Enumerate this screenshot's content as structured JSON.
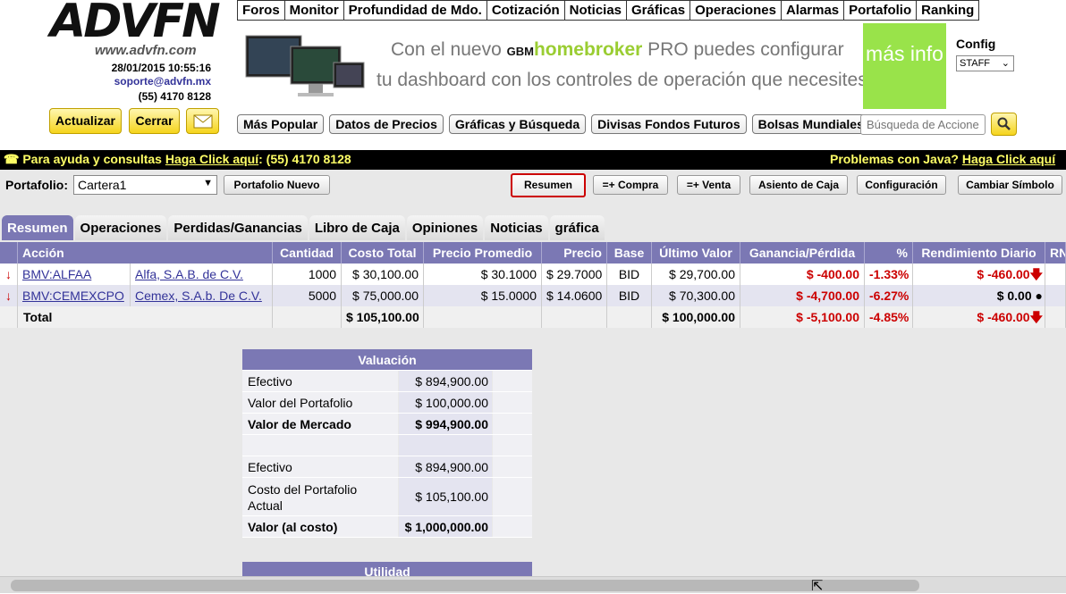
{
  "header": {
    "logo": "ADVFN",
    "logo_url": "www.advfn.com",
    "datetime": "28/01/2015 10:55:16",
    "support_email": "soporte@advfn.mx",
    "support_phone": "(55) 4170 8128",
    "refresh_label": "Actualizar",
    "close_label": "Cerrar",
    "mail_icon": "envelope-icon"
  },
  "topnav": [
    "Foros",
    "Monitor",
    "Profundidad de Mdo.",
    "Cotización",
    "Noticias",
    "Gráficas",
    "Operaciones",
    "Alarmas",
    "Portafolio",
    "Ranking"
  ],
  "banner": {
    "prefix": "Con el nuevo ",
    "brand_a": "GBM",
    "brand_b": "homebroker",
    "suffix": " PRO puedes configurar",
    "line2": "tu dashboard con los controles de operación que necesites",
    "more_info": "más info"
  },
  "config": {
    "label": "Config",
    "value": "STAFF"
  },
  "subnav": [
    "Más Popular",
    "Datos de Precios",
    "Gráficas y Búsqueda",
    "Divisas Fondos Futuros",
    "Bolsas Mundiales"
  ],
  "search": {
    "placeholder": "Búsqueda de Acciones"
  },
  "helpbar": {
    "left_prefix": "Para ayuda y consultas ",
    "left_link": "Haga Click aquí",
    "left_suffix": ": (55) 4170 8128",
    "right_prefix": "Problemas con Java? ",
    "right_link": "Haga Click aquí"
  },
  "portfolio": {
    "label": "Portafolio:",
    "selected": "Cartera1",
    "new_button": "Portafolio Nuevo",
    "actions": [
      "Resumen",
      "=+ Compra",
      "=+ Venta",
      "Asiento de Caja",
      "Configuración",
      "Cambiar Símbolo"
    ]
  },
  "tabs": [
    "Resumen",
    "Operaciones",
    "Perdidas/Ganancias",
    "Libro de Caja",
    "Opiniones",
    "Noticias",
    "gráfica"
  ],
  "table": {
    "headers": [
      "Acción",
      "Cantidad",
      "Costo Total",
      "Precio Promedio",
      "Precio",
      "Base",
      "Último Valor",
      "Ganancia/Pérdida",
      "%",
      "Rendimiento Diario",
      "RN"
    ],
    "rows": [
      {
        "symbol": "BMV:ALFAA",
        "name": "Alfa, S.A.B. de C.V.",
        "qty": "1000",
        "cost": "$ 30,100.00",
        "avg": "$ 30.1000",
        "price": "$ 29.7000",
        "base": "BID",
        "last": "$ 29,700.00",
        "gain": "$ -400.00",
        "pct": "-1.33%",
        "daily": "$ -460.00"
      },
      {
        "symbol": "BMV:CEMEXCPO",
        "name": "Cemex, S.A.b. De C.V.",
        "qty": "5000",
        "cost": "$ 75,000.00",
        "avg": "$ 15.0000",
        "price": "$ 14.0600",
        "base": "BID",
        "last": "$ 70,300.00",
        "gain": "$ -4,700.00",
        "pct": "-6.27%",
        "daily": "$ 0.00"
      }
    ],
    "total": {
      "label": "Total",
      "cost": "$ 105,100.00",
      "last": "$ 100,000.00",
      "gain": "$ -5,100.00",
      "pct": "-4.85%",
      "daily": "$ -460.00"
    }
  },
  "valuation": {
    "title": "Valuación",
    "rows": [
      {
        "label": "Efectivo",
        "value": "$ 894,900.00"
      },
      {
        "label": "Valor del Portafolio",
        "value": "$ 100,000.00"
      },
      {
        "label": "Valor de Mercado",
        "value": "$ 994,900.00"
      },
      {
        "label": "",
        "value": ""
      },
      {
        "label": "Efectivo",
        "value": "$ 894,900.00"
      },
      {
        "label": "Costo del Portafolio Actual",
        "value": "$ 105,100.00"
      },
      {
        "label": "Valor (al costo)",
        "value": "$ 1,000,000.00"
      }
    ],
    "next_title": "Utilidad"
  },
  "colors": {
    "header_purple": "#7b78b4",
    "negative": "#cc0000",
    "help_yellow": "#ffff66",
    "button_yellow": "#f5d41c",
    "promo_green": "#99e34a"
  }
}
